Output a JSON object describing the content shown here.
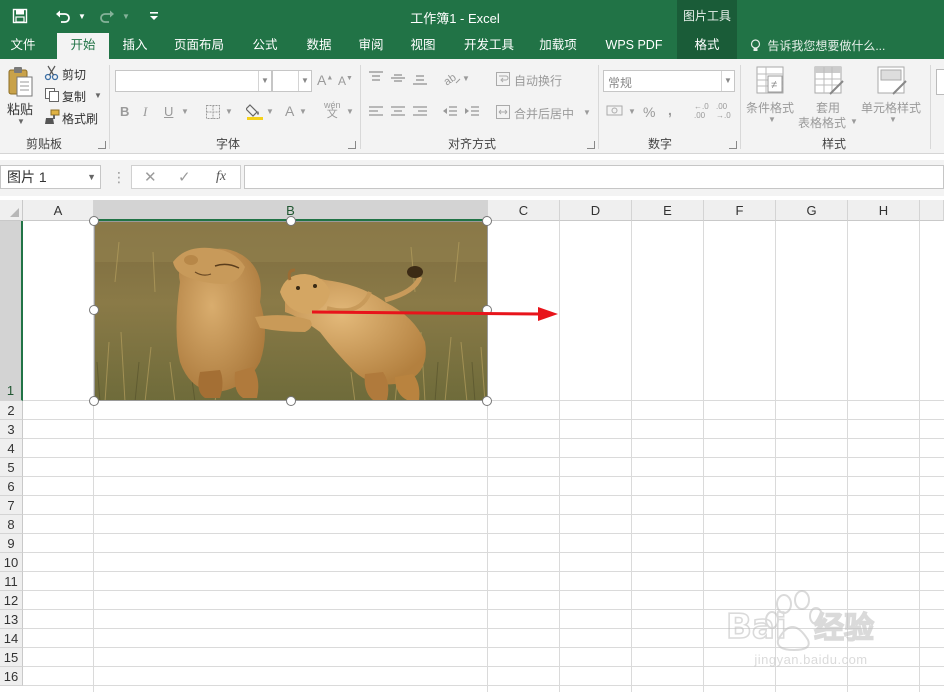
{
  "app": {
    "title": "工作簿1 - Excel",
    "context_tab_group": "图片工具",
    "accent_color": "#217346"
  },
  "quick_access": {
    "save_icon": "save-icon",
    "undo_icon": "undo-icon",
    "redo_icon": "redo-icon",
    "customize_icon": "customize-quick-access-icon"
  },
  "tabs": [
    {
      "label": "文件"
    },
    {
      "label": "开始",
      "active": true
    },
    {
      "label": "插入"
    },
    {
      "label": "页面布局"
    },
    {
      "label": "公式"
    },
    {
      "label": "数据"
    },
    {
      "label": "审阅"
    },
    {
      "label": "视图"
    },
    {
      "label": "开发工具"
    },
    {
      "label": "加载项"
    },
    {
      "label": "WPS PDF"
    },
    {
      "label": "格式",
      "contextual": true
    }
  ],
  "tell_me": "告诉我您想要做什么...",
  "ribbon": {
    "clipboard": {
      "paste": "粘贴",
      "cut": "剪切",
      "copy": "复制",
      "format_painter": "格式刷",
      "group_label": "剪贴板"
    },
    "font": {
      "font_name": "",
      "font_size": "",
      "bold": "B",
      "italic": "I",
      "underline": "U",
      "group_label": "字体"
    },
    "alignment": {
      "wrap_text": "自动换行",
      "merge_center": "合并后居中",
      "group_label": "对齐方式"
    },
    "number": {
      "format": "常规",
      "percent": "%",
      "comma": ",",
      "group_label": "数字"
    },
    "styles": {
      "conditional_formatting": "条件格式",
      "format_as_table_line1": "套用",
      "format_as_table_line2": "表格格式",
      "cell_styles": "单元格样式",
      "group_label": "样式"
    }
  },
  "formula_bar": {
    "name_box": "图片 1",
    "cancel": "✕",
    "enter": "✓",
    "fx": "fx",
    "formula": ""
  },
  "sheet": {
    "columns": [
      "A",
      "B",
      "C",
      "D",
      "E",
      "F",
      "G",
      "H"
    ],
    "rows": [
      "1",
      "2",
      "3",
      "4",
      "5",
      "6",
      "7",
      "8",
      "9",
      "10",
      "11",
      "12",
      "13",
      "14",
      "15",
      "16"
    ],
    "selected_column": "B",
    "selected_row": "1"
  },
  "picture": {
    "name": "图片 1",
    "subject": "lion cubs playing"
  },
  "annotation": {
    "arrow_color": "#e8141b"
  },
  "watermark": {
    "brand": "Baidu经验",
    "url": "jingyan.baidu.com"
  }
}
